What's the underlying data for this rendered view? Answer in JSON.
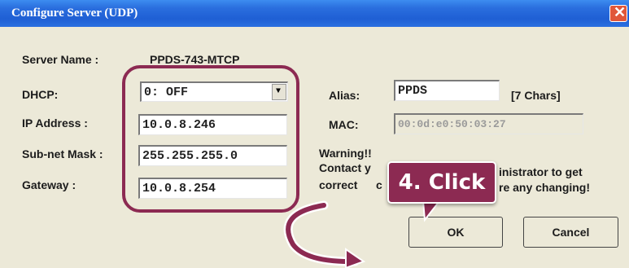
{
  "window": {
    "title": "Configure Server (UDP)",
    "close_glyph": "✕"
  },
  "server": {
    "label": "Server Name :",
    "value": "PPDS-743-MTCP"
  },
  "dhcp": {
    "label": "DHCP:",
    "value": "0: OFF",
    "arrow_glyph": "▼"
  },
  "ip": {
    "label": "IP Address :",
    "value": "10.0.8.246"
  },
  "subnet": {
    "label": "Sub-net Mask :",
    "value": "255.255.255.0"
  },
  "gateway": {
    "label": "Gateway :",
    "value": "10.0.8.254"
  },
  "alias": {
    "label": "Alias:",
    "value": "PPDS",
    "hint": "[7 Chars]"
  },
  "mac": {
    "label": "MAC:",
    "value": "00:0d:e0:50:03:27"
  },
  "warning": {
    "title": "Warning!!",
    "line1_a": "Contact y",
    "line1_b": "inistrator to get",
    "line2_a": "correct",
    "line2_b": "c",
    "line2_c": "re any changing!"
  },
  "buttons": {
    "ok": "OK",
    "cancel": "Cancel"
  },
  "annotation": {
    "step": "4. Click",
    "accent_color": "#8c2a52"
  }
}
